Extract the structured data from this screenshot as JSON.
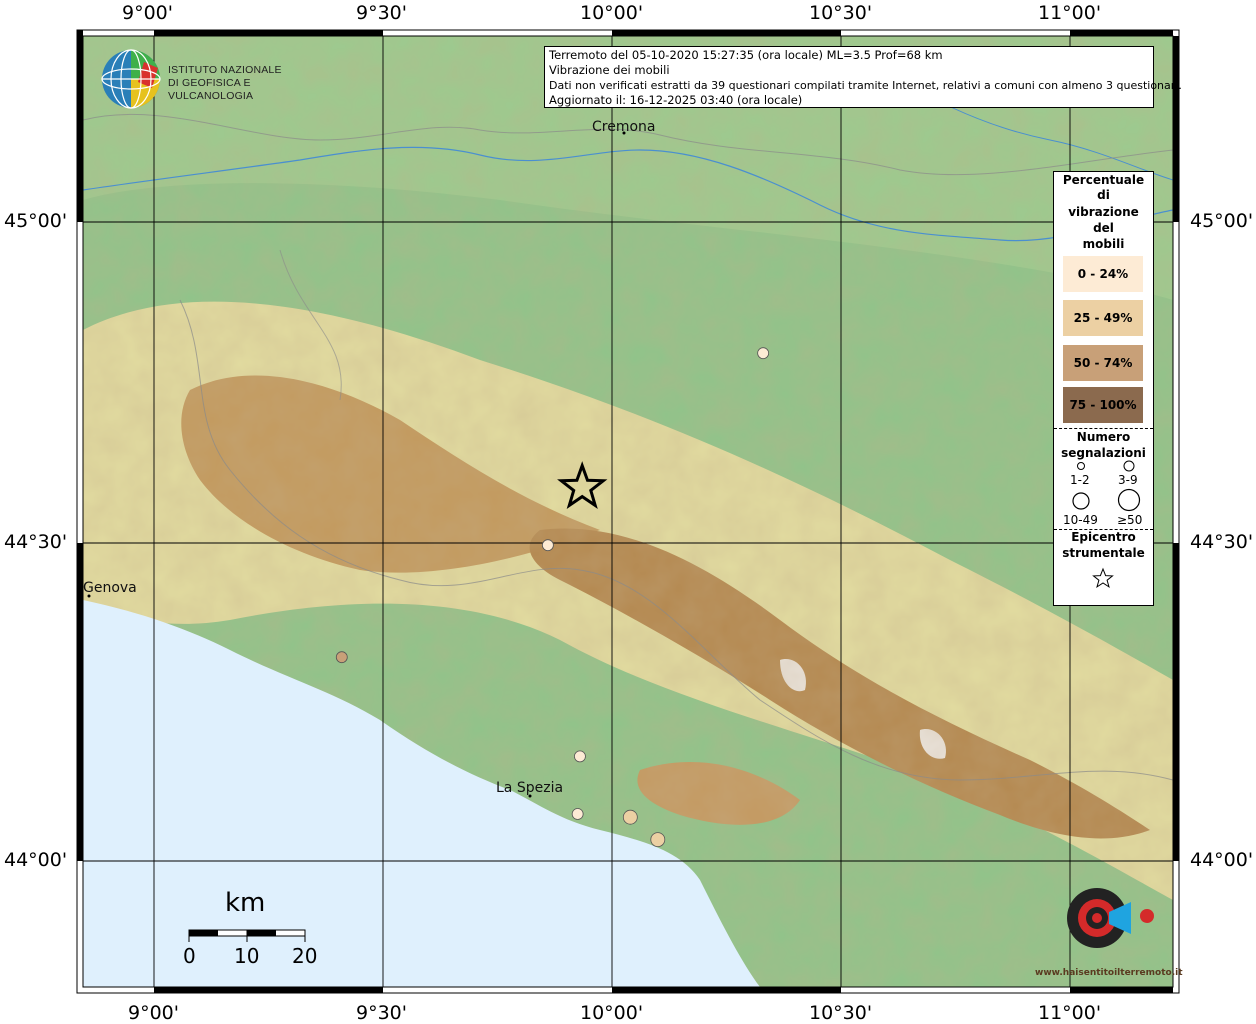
{
  "map": {
    "lon_labels_top": [
      "9°00'",
      "9°30'",
      "10°00'",
      "10°30'",
      "11°00'"
    ],
    "lon_labels_bottom": [
      "9°00'",
      "9°30'",
      "10°00'",
      "10°30'",
      "11°00'"
    ],
    "lat_labels_left": [
      "45°00'",
      "44°30'",
      "44°00'"
    ],
    "lat_labels_right": [
      "45°00'",
      "44°30'",
      "44°00'"
    ],
    "colors": {
      "sea": "#dff0fd",
      "plain": "#8fc48a",
      "hills": "#e8e0a8",
      "mountains": "#b88a52",
      "peaks": "#ece6e0"
    }
  },
  "info": {
    "line1": "Terremoto del 05-10-2020 15:27:35 (ora locale) ML=3.5 Prof=68 km",
    "line2": "Vibrazione dei mobili",
    "line3": "Dati non verificati estratti da 39 questionari compilati tramite Internet, relativi a comuni con almeno 3 questionari.",
    "line4": "Aggiornato il: 16-12-2025 03:40 (ora locale)"
  },
  "logo": {
    "line1": "ISTITUTO NAZIONALE",
    "line2": "DI GEOFISICA E VULCANOLOGIA"
  },
  "cities": [
    {
      "name": "Cremona"
    },
    {
      "name": "Genova"
    },
    {
      "name": "La Spezia"
    }
  ],
  "legend": {
    "title_lines": [
      "Percentuale",
      "di",
      "vibrazione",
      "del",
      "mobili"
    ],
    "classes": [
      {
        "label": "0 - 24%",
        "color": "#fdebd5"
      },
      {
        "label": "25 - 49%",
        "color": "#ecd0a3"
      },
      {
        "label": "50 - 74%",
        "color": "#c8a078"
      },
      {
        "label": "75 - 100%",
        "color": "#8b6a4e"
      }
    ],
    "count_title": [
      "Numero",
      "segnalazioni"
    ],
    "sizes": [
      "1-2",
      "3-9",
      "10-49",
      "≥50"
    ],
    "epicenter_title": [
      "Epicentro",
      "strumentale"
    ]
  },
  "scalebar": {
    "unit": "km",
    "ticks": [
      "0",
      "10",
      "20"
    ]
  },
  "watermark": {
    "text": "www.haisentitoilterremoto.it",
    "icon": "hsit-logo-icon"
  },
  "observations": [
    {
      "lon": 10.33,
      "lat": 44.795,
      "class": 0
    },
    {
      "lon": 9.86,
      "lat": 44.495,
      "class": 0
    },
    {
      "lon": 9.41,
      "lat": 44.32,
      "class": 2
    },
    {
      "lon": 9.93,
      "lat": 44.165,
      "class": 0
    },
    {
      "lon": 9.925,
      "lat": 44.075,
      "class": 0
    },
    {
      "lon": 10.04,
      "lat": 44.07,
      "class": 1
    },
    {
      "lon": 10.1,
      "lat": 44.035,
      "class": 1
    }
  ],
  "epicenter": {
    "lon": 9.935,
    "lat": 44.585
  }
}
